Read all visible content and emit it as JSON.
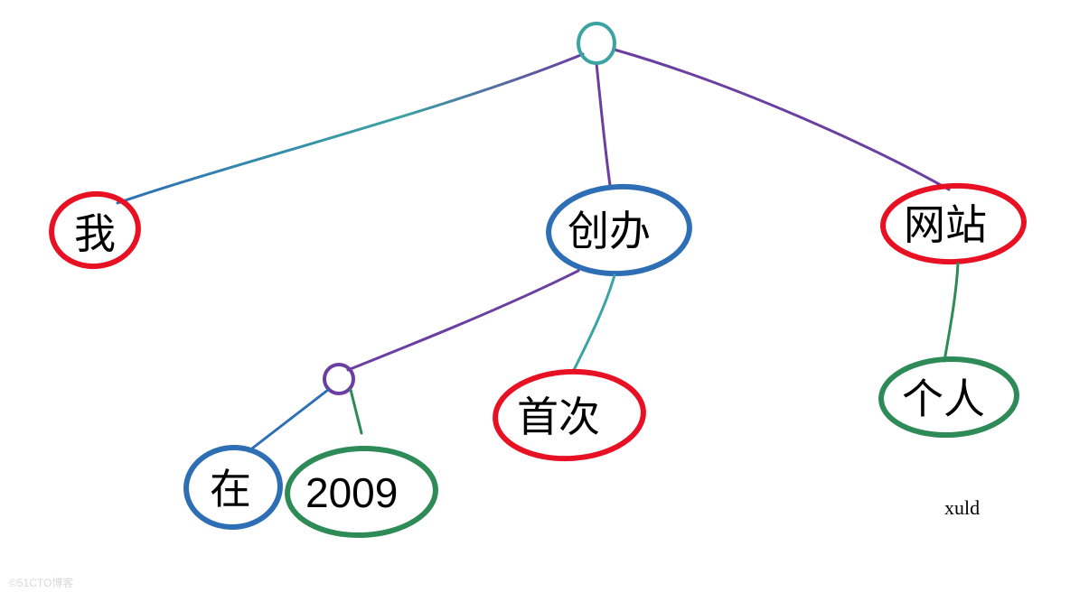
{
  "diagram": {
    "type": "syntax-tree",
    "root": {
      "label": ""
    },
    "nodes": {
      "subject": {
        "text": "我",
        "color": "red"
      },
      "verb": {
        "text": "创办",
        "color": "blue"
      },
      "object": {
        "text": "网站",
        "color": "red"
      },
      "sub_root": {
        "text": ""
      },
      "preposition": {
        "text": "在",
        "color": "blue"
      },
      "year": {
        "text": "2009",
        "color": "green"
      },
      "adverb": {
        "text": "首次",
        "color": "red"
      },
      "modifier": {
        "text": "个人",
        "color": "green"
      }
    },
    "signature": "xuld",
    "watermark": "©51CTO博客"
  },
  "colors": {
    "red": "#E81123",
    "blue": "#2E6EB5",
    "green": "#2E8B57",
    "purple": "#6A3FA0",
    "teal": "#3BA3A3"
  }
}
